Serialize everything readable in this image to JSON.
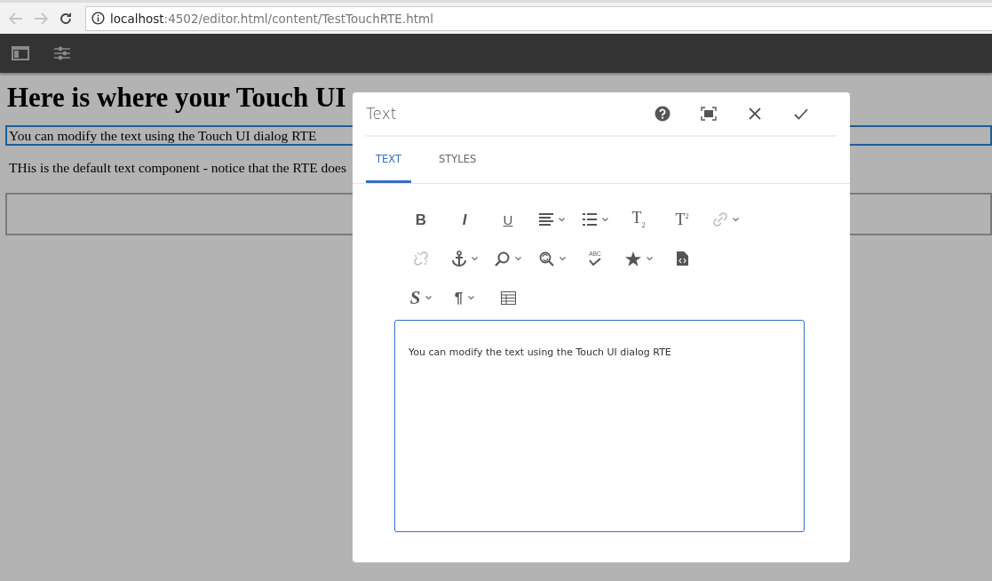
{
  "browser": {
    "back_disabled": true,
    "forward_disabled": true,
    "address": {
      "host": "localhost",
      "path": ":4502/editor.html/content/TestTouchRTE.html"
    }
  },
  "editor_bar": {
    "buttons": [
      {
        "kind": "sidebar"
      },
      {
        "kind": "properties"
      }
    ]
  },
  "page": {
    "heading": "Here is where your Touch UI",
    "paragraphs": [
      {
        "text": "You can modify the text using the Touch UI dialog RTE",
        "selected": true
      },
      {
        "text": "THis is the default text component - notice that the RTE does",
        "selected": false
      }
    ],
    "empty_box": true
  },
  "dialog": {
    "title": "Text",
    "actions": [
      {
        "kind": "help"
      },
      {
        "kind": "fullscreen"
      },
      {
        "kind": "close"
      },
      {
        "kind": "done"
      }
    ],
    "tabs": [
      {
        "label": "TEXT",
        "selected": true
      },
      {
        "label": "STYLES",
        "selected": false
      }
    ],
    "toolbar": [
      [
        {
          "kind": "bold",
          "glyph": "B",
          "caret": false,
          "disabled": false
        },
        {
          "kind": "italic",
          "glyph": "I",
          "caret": false,
          "disabled": false
        },
        {
          "kind": "underline",
          "glyph": "U",
          "caret": false,
          "disabled": false
        },
        {
          "kind": "align",
          "caret": true,
          "disabled": false
        },
        {
          "kind": "list",
          "caret": true,
          "disabled": false
        },
        {
          "kind": "subscript",
          "glyph": "T$_{2}$",
          "caret": false,
          "disabled": false
        },
        {
          "kind": "superscript",
          "glyph": "T$^{2}$",
          "caret": false,
          "disabled": false
        },
        {
          "kind": "link",
          "caret": true,
          "disabled": true
        }
      ],
      [
        {
          "kind": "unlink",
          "caret": false,
          "disabled": true
        },
        {
          "kind": "anchor",
          "caret": true,
          "disabled": false
        },
        {
          "kind": "find",
          "caret": true,
          "disabled": false
        },
        {
          "kind": "replace",
          "caret": true,
          "disabled": false
        },
        {
          "kind": "spellcheck",
          "glyph": "ABC",
          "caret": false,
          "disabled": false
        },
        {
          "kind": "star",
          "caret": true,
          "disabled": false
        },
        {
          "kind": "source",
          "caret": false,
          "disabled": false
        }
      ],
      [
        {
          "kind": "styles",
          "glyph": "S",
          "caret": true,
          "disabled": false
        },
        {
          "kind": "paragraph",
          "glyph": "¶",
          "caret": true,
          "disabled": false
        },
        {
          "kind": "table",
          "caret": false,
          "disabled": false
        }
      ]
    ],
    "editor_text": "You can modify the text using the Touch UI dialog RTE"
  }
}
